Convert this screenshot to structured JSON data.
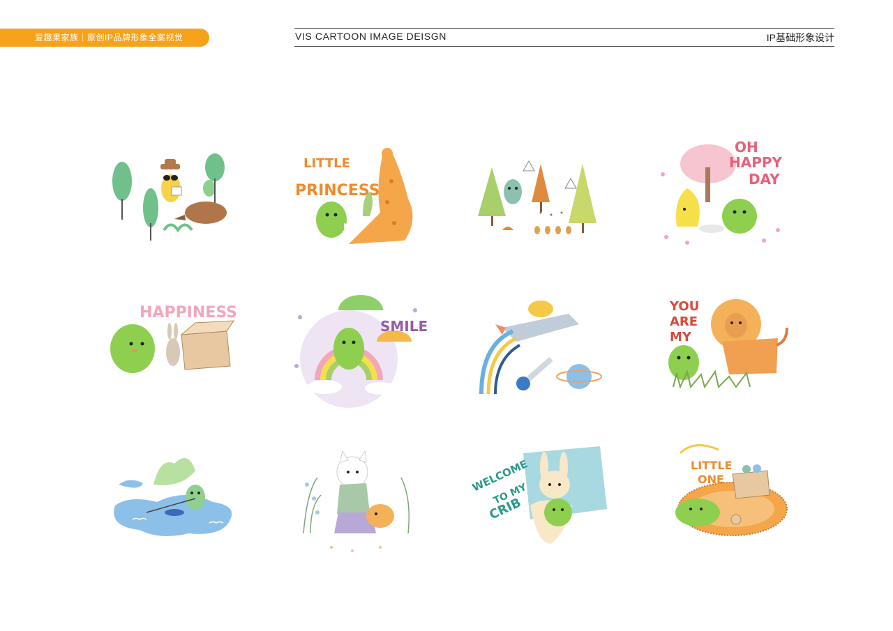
{
  "brand": {
    "tab_label": "爱趣果家族｜原创IP品牌形象全案视觉",
    "accent": "#f7a21b"
  },
  "header": {
    "left_title": "VIS CARTOON IMAGE DEISGN",
    "right_title": "IP基础形象设计"
  },
  "stickers": [
    {
      "icon": "forest-reading-icon"
    },
    {
      "icon": "giraffe-icon",
      "words": [
        "LITTLE",
        "PRINCESS"
      ]
    },
    {
      "icon": "pine-trail-icon"
    },
    {
      "icon": "picnic-icon",
      "words": [
        "OH",
        "HAPPY",
        "DAY"
      ]
    },
    {
      "icon": "gift-box-icon",
      "words": [
        "HAPPINESS"
      ]
    },
    {
      "icon": "umbrella-rainbow-icon",
      "words": [
        "SMILE"
      ]
    },
    {
      "icon": "rocket-planet-icon"
    },
    {
      "icon": "lion-icon",
      "words": [
        "YOU",
        "ARE",
        "MY"
      ]
    },
    {
      "icon": "puddle-fishing-icon"
    },
    {
      "icon": "cat-walk-icon"
    },
    {
      "icon": "bunny-pillow-icon",
      "words": [
        "WELCOME",
        "TO MY",
        "CRIB"
      ]
    },
    {
      "icon": "rug-nap-icon",
      "words": [
        "LITTLE",
        "ONE"
      ]
    }
  ],
  "colors": {
    "dino": "#8fcf4f",
    "dino_dark": "#6db33a",
    "orange": "#f08a2a",
    "pink": "#f2a7b8",
    "blue": "#8cc0e8"
  }
}
